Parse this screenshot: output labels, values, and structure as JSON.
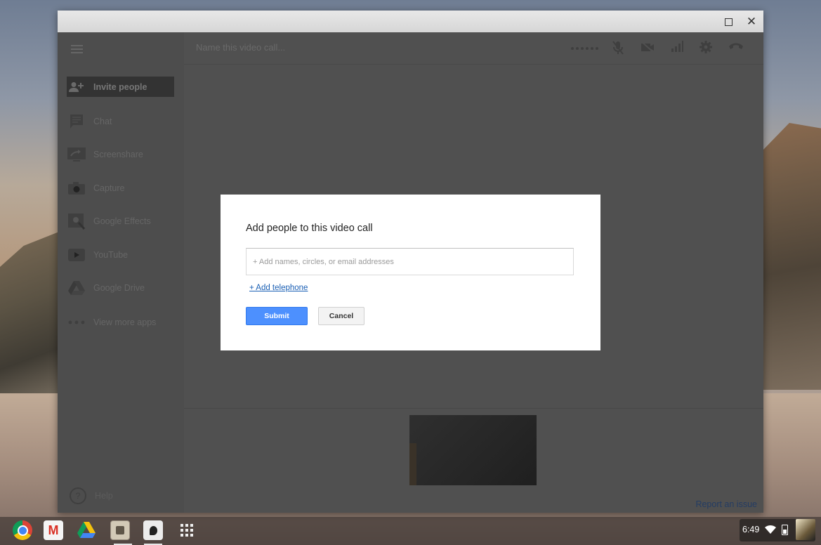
{
  "window": {
    "controls": {
      "maximize_icon": "maximize-icon",
      "close_icon": "close-icon",
      "close_glyph": "✕"
    }
  },
  "sidebar": {
    "items": [
      {
        "label": "Invite people",
        "icon": "add-person-icon",
        "active": true
      },
      {
        "label": "Chat",
        "icon": "chat-icon"
      },
      {
        "label": "Screenshare",
        "icon": "screenshare-icon"
      },
      {
        "label": "Capture",
        "icon": "camera-icon"
      },
      {
        "label": "Google Effects",
        "icon": "effects-icon"
      },
      {
        "label": "YouTube",
        "icon": "youtube-icon"
      },
      {
        "label": "Google Drive",
        "icon": "drive-icon"
      },
      {
        "label": "View more apps",
        "icon": "more-icon"
      }
    ],
    "help_label": "Help"
  },
  "topbar": {
    "call_name_placeholder": "Name this video call...",
    "tools": [
      "signal-dots-icon",
      "mute-mic-icon",
      "camera-off-icon",
      "bandwidth-icon",
      "settings-icon",
      "hang-up-icon"
    ]
  },
  "dialog": {
    "title": "Add people to this video call",
    "input_placeholder": "+ Add names, circles, or email addresses",
    "add_telephone": "+ Add telephone",
    "submit_label": "Submit",
    "cancel_label": "Cancel"
  },
  "footer": {
    "report_issue": "Report an issue"
  },
  "shelf": {
    "apps": [
      "chrome-icon",
      "gmail-icon",
      "drive-icon",
      "photo-app-icon",
      "hangouts-icon",
      "app-launcher-icon"
    ],
    "clock": "6:49"
  },
  "colors": {
    "accent_blue": "#4d90fe",
    "link_blue": "#1a5fb4",
    "sidebar_bg": "#4d4d4d",
    "overlay": "#505050"
  }
}
